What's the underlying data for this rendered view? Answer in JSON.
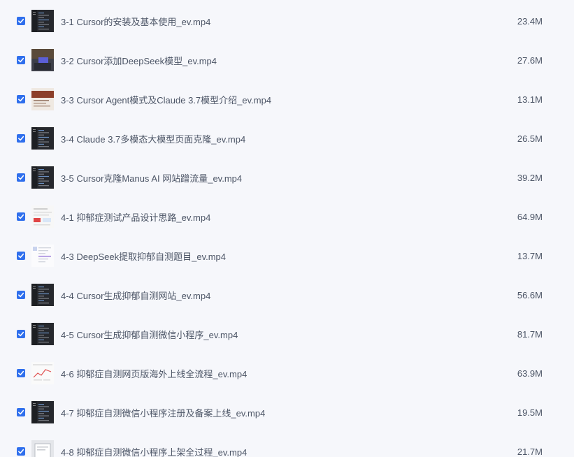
{
  "accent_color": "#2f6fed",
  "files": [
    {
      "name": "3-1 Cursor的安装及基本使用_ev.mp4",
      "size": "23.4M",
      "checked": true,
      "thumb": "dark-editor-icon"
    },
    {
      "name": "3-2 Cursor添加DeepSeek模型_ev.mp4",
      "size": "27.6M",
      "checked": true,
      "thumb": "video-frame-icon"
    },
    {
      "name": "3-3 Cursor Agent模式及Claude 3.7模型介绍_ev.mp4",
      "size": "13.1M",
      "checked": true,
      "thumb": "slide-brown-icon"
    },
    {
      "name": "3-4 Claude 3.7多模态大模型页面克隆_ev.mp4",
      "size": "26.5M",
      "checked": true,
      "thumb": "dark-editor-icon"
    },
    {
      "name": "3-5 Cursor克隆Manus AI 网站蹭流量_ev.mp4",
      "size": "39.2M",
      "checked": true,
      "thumb": "dark-editor-icon"
    },
    {
      "name": "4-1 抑郁症测试产品设计思路_ev.mp4",
      "size": "64.9M",
      "checked": true,
      "thumb": "light-page-icon"
    },
    {
      "name": "4-3 DeepSeek提取抑郁自测题目_ev.mp4",
      "size": "13.7M",
      "checked": true,
      "thumb": "light-doc-icon"
    },
    {
      "name": "4-4 Cursor生成抑郁自测网站_ev.mp4",
      "size": "56.6M",
      "checked": true,
      "thumb": "dark-editor-icon"
    },
    {
      "name": "4-5 Cursor生成抑郁自测微信小程序_ev.mp4",
      "size": "81.7M",
      "checked": true,
      "thumb": "dark-editor-icon"
    },
    {
      "name": "4-6 抑郁症自测网页版海外上线全流程_ev.mp4",
      "size": "63.9M",
      "checked": true,
      "thumb": "light-chart-icon"
    },
    {
      "name": "4-7 抑郁症自测微信小程序注册及备案上线_ev.mp4",
      "size": "19.5M",
      "checked": true,
      "thumb": "dark-editor-icon"
    },
    {
      "name": "4-8 抑郁症自测微信小程序上架全过程_ev.mp4",
      "size": "21.7M",
      "checked": true,
      "thumb": "gray-window-icon"
    }
  ]
}
